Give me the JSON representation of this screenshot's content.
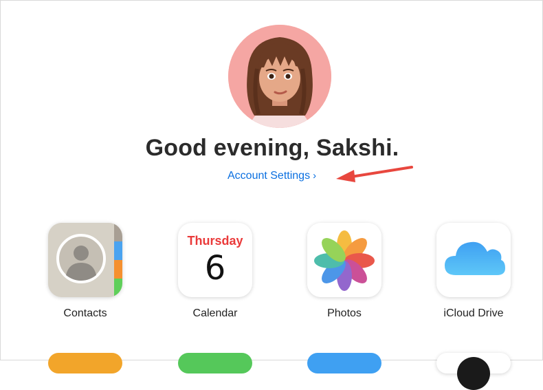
{
  "greeting": "Good evening, Sakshi.",
  "account_settings": {
    "label": "Account Settings",
    "chevron": "›"
  },
  "apps": [
    {
      "name": "Contacts",
      "icon": "contacts-icon"
    },
    {
      "name": "Calendar",
      "icon": "calendar-icon",
      "weekday": "Thursday",
      "day": "6"
    },
    {
      "name": "Photos",
      "icon": "photos-icon"
    },
    {
      "name": "iCloud Drive",
      "icon": "cloud-icon"
    }
  ],
  "colors": {
    "link": "#0a6fe0",
    "annotation_arrow": "#e8473e",
    "calendar_red": "#ea3a3a"
  }
}
